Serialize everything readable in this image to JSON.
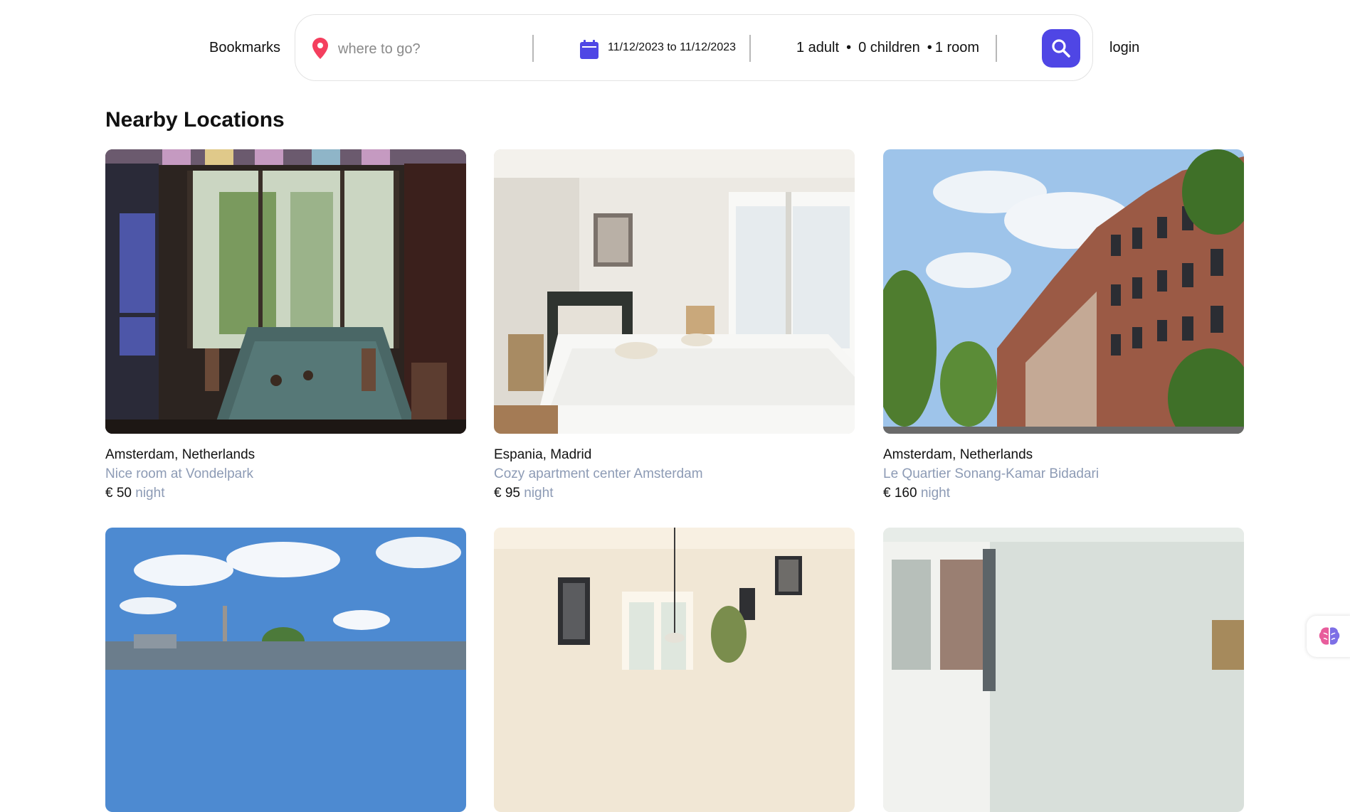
{
  "header": {
    "bookmarks_label": "Bookmarks",
    "login_label": "login",
    "search": {
      "destination_placeholder": "where to go?",
      "dates": "11/12/2023 to 11/12/2023",
      "adults": "1 adult",
      "children": "0 children",
      "rooms": "1 room",
      "separator": "•"
    },
    "accent_color": "#4f46e5",
    "pin_color": "#f43f5e"
  },
  "section": {
    "title": "Nearby Locations"
  },
  "listings": [
    {
      "location": "Amsterdam, Netherlands",
      "name": "Nice room at Vondelpark",
      "price": "€ 50",
      "unit": "night"
    },
    {
      "location": "Espania, Madrid",
      "name": "Cozy apartment center Amsterdam",
      "price": "€ 95",
      "unit": "night"
    },
    {
      "location": "Amsterdam, Netherlands",
      "name": "Le Quartier Sonang-Kamar Bidadari",
      "price": "€ 160",
      "unit": "night"
    }
  ]
}
